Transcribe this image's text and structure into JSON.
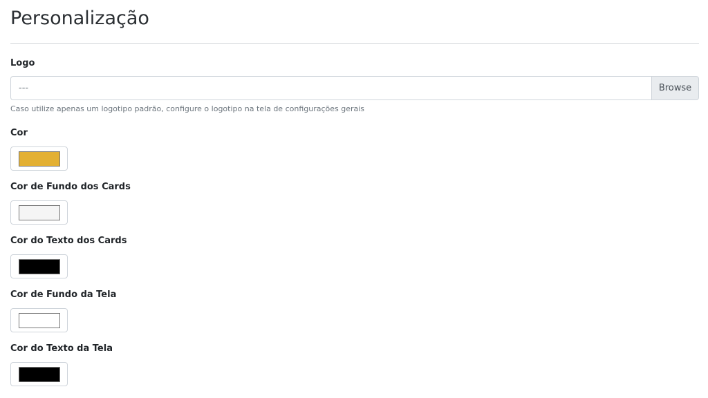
{
  "page": {
    "title": "Personalização"
  },
  "logo": {
    "label": "Logo",
    "file_value": "---",
    "browse_label": "Browse",
    "help": "Caso utilize apenas um logotipo padrão, configure o logotipo na tela de configurações gerais"
  },
  "colors": {
    "main": {
      "label": "Cor",
      "value": "#e3b033"
    },
    "card_background": {
      "label": "Cor de Fundo dos Cards",
      "value": "#f5f5f5"
    },
    "card_text": {
      "label": "Cor do Texto dos Cards",
      "value": "#000000"
    },
    "screen_background": {
      "label": "Cor de Fundo da Tela",
      "value": "#ffffff"
    },
    "screen_text": {
      "label": "Cor do Texto da Tela",
      "value": "#000000"
    }
  }
}
